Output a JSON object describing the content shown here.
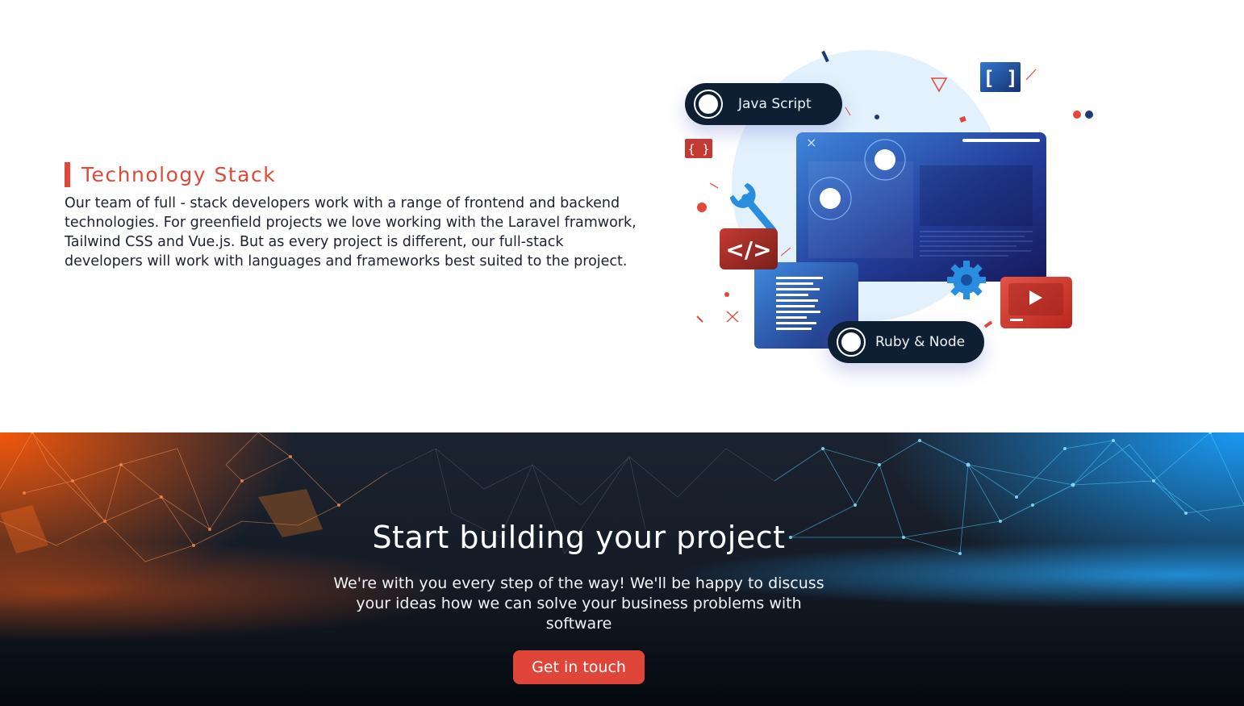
{
  "tech_stack": {
    "title": "Technology Stack",
    "description": "Our team of full - stack developers work with a range of frontend and backend technologies. For greenfield projects we love working with the Laravel framwork, Tailwind CSS and Vue.js. But as every project is different, our full-stack developers will work with languages and frameworks best suited to the project.",
    "illustration": {
      "pill_1": "Java Script",
      "pill_2": "Ruby & Node",
      "code_symbol": "</>",
      "brackets_blue": "[ ]",
      "brackets_red": "{ }"
    }
  },
  "cta": {
    "title": "Start building your project",
    "subtitle_line_1": "We're with you every step of the way! We'll be happy to discuss",
    "subtitle_line_2": "your ideas how we can solve your business problems with software",
    "button_label": "Get in touch"
  },
  "colors": {
    "accent": "#e0483a",
    "text_dark": "#1e2033",
    "pill_bg": "#0f1f33",
    "cta_orange": "#ff5a0a",
    "cta_blue": "#19a0ff"
  },
  "icons": [
    "javascript-pill-icon",
    "ruby-node-pill-icon",
    "code-icon",
    "wrench-icon",
    "gear-icon",
    "play-icon",
    "brackets-icon",
    "close-icon"
  ]
}
